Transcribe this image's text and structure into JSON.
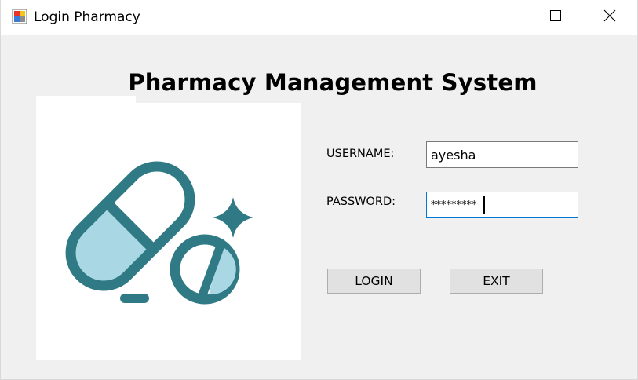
{
  "window": {
    "title": "Login Pharmacy",
    "controls": {
      "minimize_icon": "minimize-icon",
      "maximize_icon": "maximize-icon",
      "close_icon": "close-icon"
    }
  },
  "form": {
    "title": "Pharmacy Management System",
    "logo_icon": "pills-icon",
    "username_label": "USERNAME:",
    "username_value": "ayesha",
    "password_label": "PASSWORD:",
    "password_value": "*********",
    "login_label": "LOGIN",
    "exit_label": "EXIT"
  },
  "colors": {
    "logo_stroke": "#2f7a85",
    "logo_fill": "#a9d8e4",
    "focus_border": "#0078d7",
    "window_bg": "#f0f0f0"
  }
}
